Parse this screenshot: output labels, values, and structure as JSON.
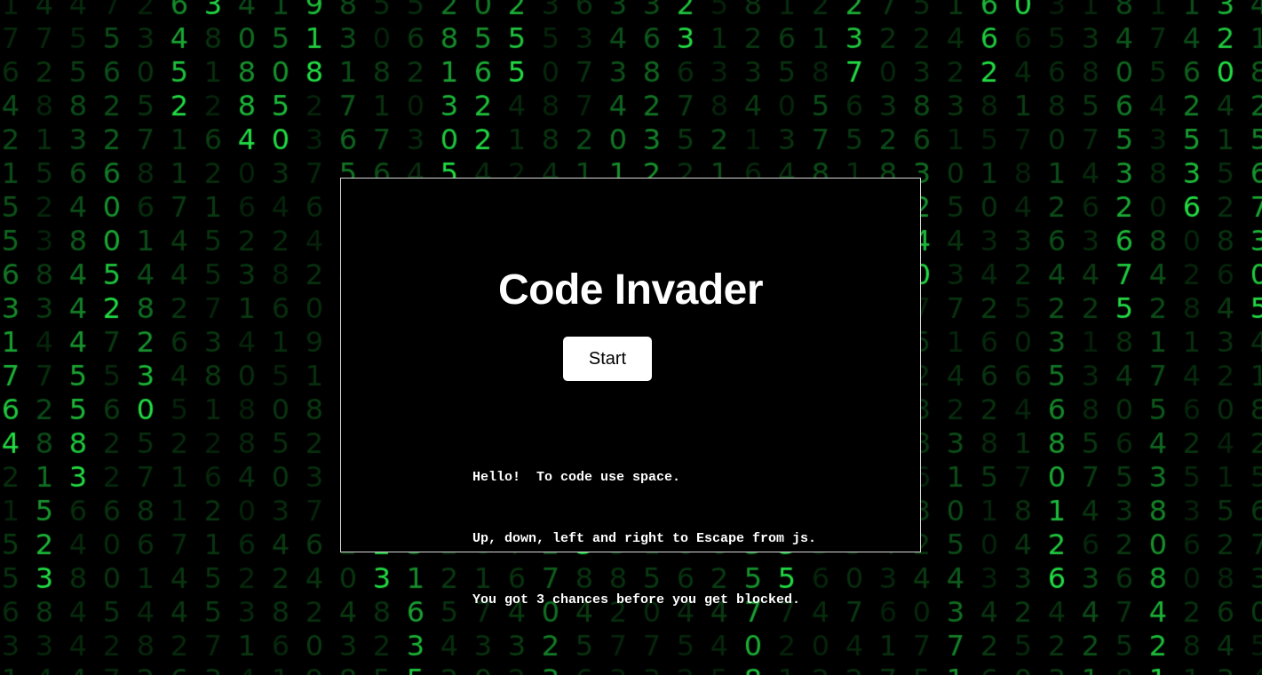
{
  "game": {
    "title": "Code Invader",
    "start_label": "Start",
    "instructions": [
      "Hello!  To code use space.",
      "Up, down, left and right to Escape from js.",
      "You got 3 chances before you get blocked."
    ]
  },
  "background": {
    "effect": "digital-rain",
    "glyphs": "0123456789",
    "bright_color": "#22dd44",
    "dim_color": "#0a3d12",
    "columns": [
      "1764215563",
      "3472815238",
      "4445583648",
      "0527562260",
      "6148230578",
      "1744264521",
      "6215573812",
      "8406231408",
      "0503428615",
      "1823764209",
      "8317652043",
      "2508176238",
      "6356203451",
      "2542813052",
      "0173056224",
      "2764325541",
      "8427023508",
      "7213845637",
      "3401582734",
      "6823215073",
      "2367520645",
      "4513821624",
      "7082341635",
      "5721650343",
      "3640218578",
      "1507423765",
      "2843617203",
      "8632407523",
      "2310543714",
      "6285103426",
      "0641784325",
      "2356801264",
      "4213857463",
      "6758406532",
      "0842175438",
      "3602814625",
      "1528643204",
      "2567305418"
    ]
  }
}
